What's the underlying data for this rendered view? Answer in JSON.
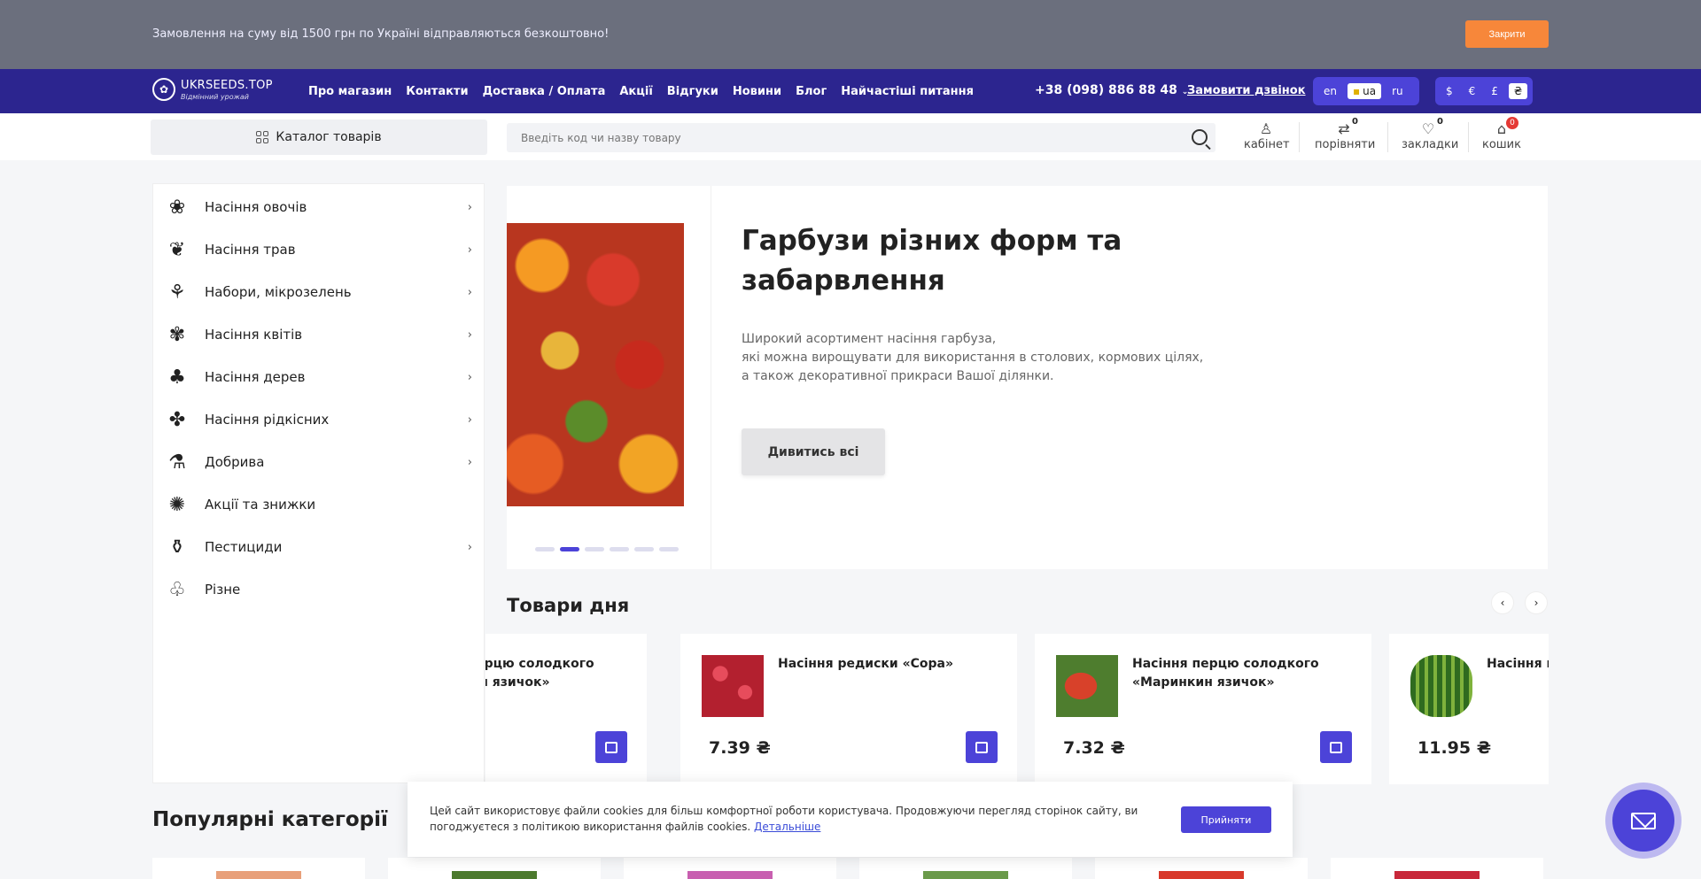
{
  "promo": {
    "text": "Замовлення на суму від 1500 грн по Україні відправляються безкоштовно!",
    "close_label": "Закрити"
  },
  "header": {
    "logo_name": "UKRSEEDS.TOP",
    "logo_tagline": "Відмінний урожай",
    "menu": [
      "Про магазин",
      "Контакти",
      "Доставка / Оплата",
      "Акції",
      "Відгуки",
      "Новини",
      "Блог",
      "Найчастіші питання"
    ],
    "phone": "+38 (098) 886 88 48",
    "callback": "Замовити дзвінок",
    "languages": [
      "en",
      "ua",
      "ru"
    ],
    "active_language": "ua",
    "currencies": [
      "$",
      "€",
      "£",
      "₴"
    ],
    "active_currency": "₴"
  },
  "toolbar": {
    "catalog_label": "Каталог товарів",
    "search_placeholder": "Введіть код чи назву товару",
    "account_label": "кабінет",
    "compare_label": "порівняти",
    "compare_count": "0",
    "wishlist_label": "закладки",
    "wishlist_count": "0",
    "cart_label": "кошик",
    "cart_count": "0"
  },
  "categories": [
    {
      "label": "Насіння овочів",
      "icon": "vegetable-icon",
      "arrow": true
    },
    {
      "label": "Насіння трав",
      "icon": "herb-icon",
      "arrow": true
    },
    {
      "label": "Набори, мікрозелень",
      "icon": "sprout-icon",
      "arrow": true
    },
    {
      "label": "Насіння квітів",
      "icon": "flower-icon",
      "arrow": true
    },
    {
      "label": "Насіння дерев",
      "icon": "tree-icon",
      "arrow": true
    },
    {
      "label": "Насіння рідкісних",
      "icon": "succulent-icon",
      "arrow": true
    },
    {
      "label": "Добрива",
      "icon": "fertilizer-icon",
      "arrow": true
    },
    {
      "label": "Акції та знижки",
      "icon": "discount-icon",
      "arrow": false
    },
    {
      "label": "Пестициди",
      "icon": "sprayer-icon",
      "arrow": true
    },
    {
      "label": "Різне",
      "icon": "garden-icon",
      "arrow": false
    }
  ],
  "hero": {
    "title": "Гарбузи різних форм та забарвлення",
    "description": [
      "Широкий асортимент насіння гарбуза,",
      "які можна вирощувати для використання в столових, кормових цілях,",
      "а також декоративної прикраси Вашої ділянки."
    ],
    "button": "Дивитись всі",
    "slide_count": 6,
    "active_slide": 2
  },
  "products_section": {
    "title": "Товари дня",
    "items": [
      {
        "name": "Насіння перцю солодкого «Маринкин язичок»",
        "price": "",
        "color": "#c0392b"
      },
      {
        "name": "Насіння редиски «Сора»",
        "price": "7.39 ₴",
        "color": "#c8283a"
      },
      {
        "name": "Насіння перцю солодкого «Маринкин язичок»",
        "price": "7.32 ₴",
        "color": "#b8321f"
      },
      {
        "name": "Насіння кавуна",
        "price": "11.95 ₴",
        "color": "#3f7d2a"
      }
    ]
  },
  "popular": {
    "title": "Популярні категорії"
  },
  "cookie": {
    "text": "Цей сайт використовує файли cookies для більш комфортної роботи користувача. Продовжуючи перегляд сторінок сайту, ви погоджуєтеся з політикою використання файлів cookies.",
    "link": "Детальніше",
    "accept": "Прийняти"
  },
  "colors": {
    "brand": "#2c258f",
    "accent": "#4c43d8",
    "promo_button": "#f7873a"
  }
}
